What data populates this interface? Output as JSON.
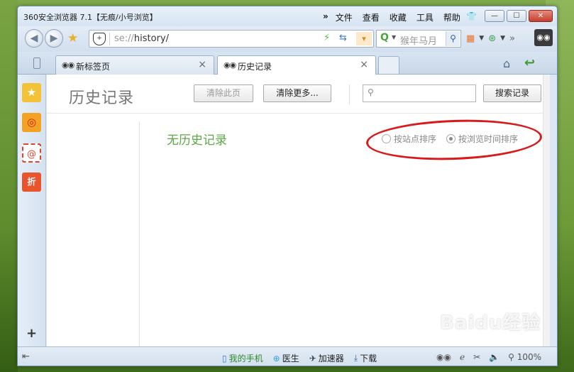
{
  "window": {
    "title": "360安全浏览器 7.1【无痕/小号浏览】",
    "menu": [
      "文件",
      "查看",
      "收藏",
      "工具",
      "帮助"
    ],
    "menu_overflow": "»",
    "buttons": {
      "minimize": "—",
      "maximize": "☐",
      "close": "✕"
    }
  },
  "navbar": {
    "back": "◀",
    "forward": "▶",
    "address_prefix": "se://",
    "address_path": "history/",
    "search_placeholder": "猴年马月",
    "overflow": "»"
  },
  "tabs": [
    {
      "label": "新标签页",
      "active": false
    },
    {
      "label": "历史记录",
      "active": true
    }
  ],
  "sidebar": {
    "items": [
      "收藏",
      "微博",
      "邮箱",
      "折扣"
    ],
    "plus": "+"
  },
  "history": {
    "title": "历史记录",
    "clear_page": "清除此页",
    "clear_more": "清除更多...",
    "search_button": "搜索记录",
    "empty_message": "无历史记录",
    "sort_options": [
      {
        "label": "按站点排序",
        "checked": false
      },
      {
        "label": "按浏览时间排序",
        "checked": true
      }
    ]
  },
  "statusbar": {
    "items": [
      "我的手机",
      "医生",
      "加速器",
      "下载"
    ],
    "zoom": "100%"
  },
  "watermark": "Baidu经验",
  "colors": {
    "accent_green": "#5aa846",
    "annotation_red": "#d91a1a"
  }
}
